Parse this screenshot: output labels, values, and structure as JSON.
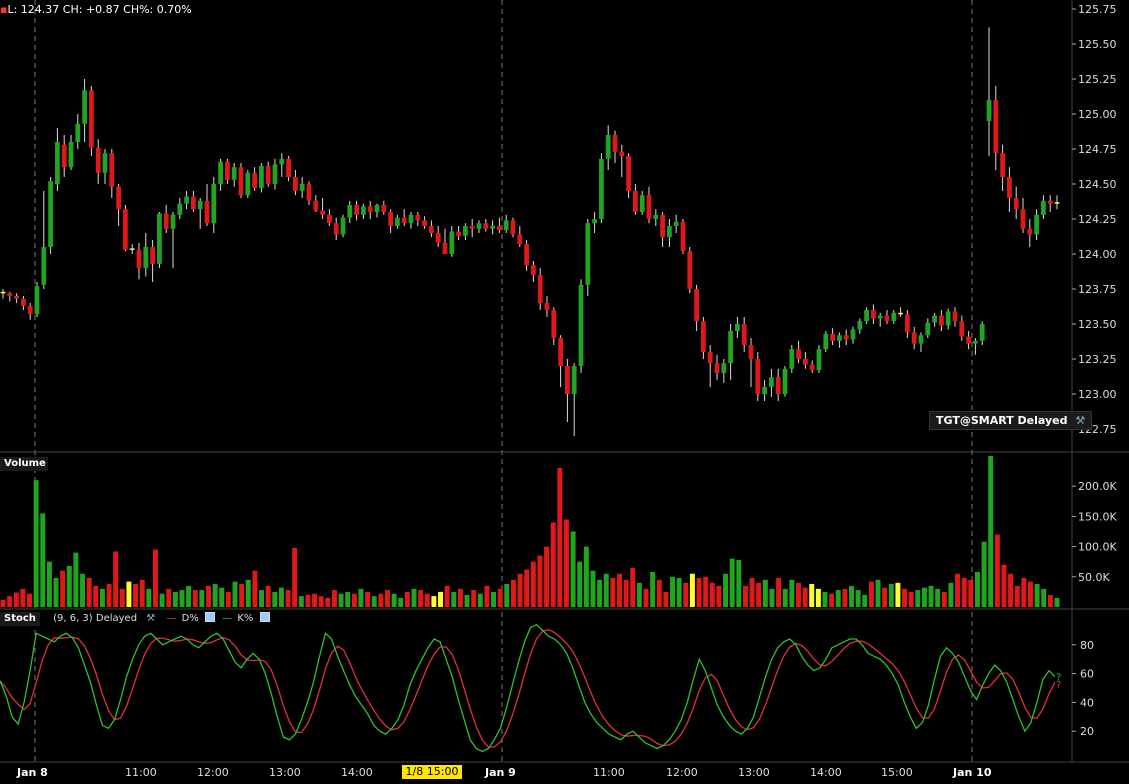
{
  "header": {
    "text": "L: 124.37 CH: +0.87 CH%: 0.70%"
  },
  "symbol_badge": "TGT@SMART Delayed",
  "panels": {
    "volume": "Volume",
    "stoch": "Stoch",
    "stoch_params": "(9, 6, 3) Delayed",
    "d_label": "D%",
    "k_label": "K%"
  },
  "x_axis": {
    "labels": [
      {
        "text": "Jan 8",
        "bold": true
      },
      {
        "text": "11:00"
      },
      {
        "text": "12:00"
      },
      {
        "text": "13:00"
      },
      {
        "text": "14:00"
      },
      {
        "text": "1/8 15:00",
        "highlight": true
      },
      {
        "text": "Jan 9",
        "bold": true
      },
      {
        "text": "11:00"
      },
      {
        "text": "12:00"
      },
      {
        "text": "13:00"
      },
      {
        "text": "14:00"
      },
      {
        "text": "15:00"
      },
      {
        "text": "Jan 10",
        "bold": true
      }
    ]
  },
  "chart_data": {
    "type": "candlestick",
    "price_axis": {
      "ticks": [
        "125.75",
        "125.50",
        "125.25",
        "125.00",
        "124.75",
        "124.50",
        "124.25",
        "124.00",
        "123.75",
        "123.50",
        "123.25",
        "123.00",
        "122.75"
      ],
      "range": [
        122.6,
        125.8
      ]
    },
    "volume_axis": {
      "ticks": [
        "200.0K",
        "150.0K",
        "100.0K",
        "50.0K"
      ],
      "range": [
        0,
        240
      ]
    },
    "stoch_axis": {
      "ticks": [
        "80",
        "60",
        "40",
        "20"
      ],
      "range": [
        0,
        100
      ]
    },
    "day_separators": [
      "Jan 8",
      "Jan 9",
      "Jan 10"
    ],
    "colors": {
      "up": "#1fa51f",
      "down": "#e01818",
      "neutral": "#ffff33",
      "d_line": "#e0303a",
      "k_line": "#30c030"
    },
    "candles": [
      [
        123.73,
        123.75,
        123.68,
        123.72
      ],
      [
        123.72,
        123.73,
        123.66,
        123.7
      ],
      [
        123.7,
        123.72,
        123.65,
        123.68
      ],
      [
        123.68,
        123.7,
        123.6,
        123.63
      ],
      [
        123.63,
        123.65,
        123.53,
        123.57
      ],
      [
        123.57,
        123.8,
        123.55,
        123.77
      ],
      [
        123.78,
        124.45,
        123.75,
        124.05
      ],
      [
        124.05,
        124.55,
        124.0,
        124.52
      ],
      [
        124.5,
        124.9,
        124.45,
        124.8
      ],
      [
        124.78,
        124.85,
        124.55,
        124.62
      ],
      [
        124.62,
        124.85,
        124.6,
        124.8
      ],
      [
        124.8,
        125.0,
        124.75,
        124.93
      ],
      [
        124.93,
        125.25,
        124.8,
        125.17
      ],
      [
        125.17,
        125.2,
        124.7,
        124.76
      ],
      [
        124.76,
        124.82,
        124.5,
        124.58
      ],
      [
        124.58,
        124.75,
        124.5,
        124.72
      ],
      [
        124.72,
        124.75,
        124.4,
        124.48
      ],
      [
        124.48,
        124.5,
        124.2,
        124.32
      ],
      [
        124.32,
        124.35,
        124.02,
        124.03
      ],
      [
        124.04,
        124.07,
        124.0,
        124.03
      ],
      [
        124.03,
        124.08,
        123.82,
        123.9
      ],
      [
        123.9,
        124.15,
        123.84,
        124.05
      ],
      [
        124.05,
        124.1,
        123.8,
        123.93
      ],
      [
        123.93,
        124.3,
        123.9,
        124.29
      ],
      [
        124.29,
        124.35,
        124.15,
        124.18
      ],
      [
        124.18,
        124.3,
        123.9,
        124.28
      ],
      [
        124.28,
        124.4,
        124.25,
        124.36
      ],
      [
        124.36,
        124.45,
        124.32,
        124.41
      ],
      [
        124.41,
        124.45,
        124.3,
        124.32
      ],
      [
        124.32,
        124.4,
        124.18,
        124.38
      ],
      [
        124.38,
        124.5,
        124.2,
        124.22
      ],
      [
        124.22,
        124.55,
        124.15,
        124.5
      ],
      [
        124.5,
        124.68,
        124.45,
        124.66
      ],
      [
        124.66,
        124.68,
        124.5,
        124.53
      ],
      [
        124.53,
        124.65,
        124.48,
        124.62
      ],
      [
        124.62,
        124.65,
        124.4,
        124.42
      ],
      [
        124.42,
        124.6,
        124.4,
        124.58
      ],
      [
        124.58,
        124.62,
        124.45,
        124.47
      ],
      [
        124.47,
        124.65,
        124.44,
        124.63
      ],
      [
        124.63,
        124.66,
        124.48,
        124.5
      ],
      [
        124.5,
        124.68,
        124.46,
        124.64
      ],
      [
        124.64,
        124.72,
        124.55,
        124.68
      ],
      [
        124.68,
        124.7,
        124.52,
        124.55
      ],
      [
        124.55,
        124.6,
        124.42,
        124.45
      ],
      [
        124.45,
        124.55,
        124.4,
        124.5
      ],
      [
        124.5,
        124.52,
        124.35,
        124.38
      ],
      [
        124.38,
        124.42,
        124.3,
        124.31
      ],
      [
        124.31,
        124.4,
        124.25,
        124.28
      ],
      [
        124.28,
        124.32,
        124.2,
        124.22
      ],
      [
        124.22,
        124.26,
        124.1,
        124.14
      ],
      [
        124.14,
        124.28,
        124.12,
        124.26
      ],
      [
        124.26,
        124.38,
        124.22,
        124.35
      ],
      [
        124.35,
        124.38,
        124.24,
        124.28
      ],
      [
        124.28,
        124.36,
        124.25,
        124.34
      ],
      [
        124.34,
        124.38,
        124.25,
        124.3
      ],
      [
        124.3,
        124.36,
        124.26,
        124.35
      ],
      [
        124.35,
        124.38,
        124.28,
        124.3
      ],
      [
        124.3,
        124.32,
        124.15,
        124.2
      ],
      [
        124.2,
        124.28,
        124.18,
        124.26
      ],
      [
        124.26,
        124.32,
        124.2,
        124.22
      ],
      [
        124.22,
        124.3,
        124.18,
        124.28
      ],
      [
        124.28,
        124.3,
        124.2,
        124.24
      ],
      [
        124.24,
        124.27,
        124.18,
        124.2
      ],
      [
        124.2,
        124.24,
        124.12,
        124.15
      ],
      [
        124.15,
        124.2,
        124.05,
        124.08
      ],
      [
        124.08,
        124.18,
        124.0,
        124.0
      ],
      [
        124.0,
        124.2,
        123.98,
        124.16
      ],
      [
        124.16,
        124.2,
        124.1,
        124.13
      ],
      [
        124.13,
        124.22,
        124.1,
        124.2
      ],
      [
        124.2,
        124.25,
        124.12,
        124.18
      ],
      [
        124.18,
        124.24,
        124.15,
        124.22
      ],
      [
        124.22,
        124.25,
        124.16,
        124.18
      ],
      [
        124.18,
        124.24,
        124.14,
        124.2
      ],
      [
        124.2,
        124.26,
        124.15,
        124.17
      ],
      [
        124.17,
        124.28,
        124.15,
        124.24
      ],
      [
        124.24,
        124.26,
        124.12,
        124.14
      ],
      [
        124.14,
        124.2,
        124.05,
        124.07
      ],
      [
        124.07,
        124.1,
        123.88,
        123.92
      ],
      [
        123.92,
        123.95,
        123.8,
        123.85
      ],
      [
        123.85,
        123.9,
        123.6,
        123.65
      ],
      [
        123.65,
        123.7,
        123.55,
        123.6
      ],
      [
        123.6,
        123.62,
        123.35,
        123.4
      ],
      [
        123.4,
        123.42,
        123.05,
        123.2
      ],
      [
        123.2,
        123.25,
        122.8,
        123.0
      ],
      [
        123.0,
        123.22,
        122.7,
        123.2
      ],
      [
        123.2,
        123.82,
        123.15,
        123.78
      ],
      [
        123.78,
        124.25,
        123.7,
        124.22
      ],
      [
        124.22,
        124.3,
        124.15,
        124.25
      ],
      [
        124.25,
        124.72,
        124.22,
        124.68
      ],
      [
        124.68,
        124.92,
        124.6,
        124.85
      ],
      [
        124.85,
        124.88,
        124.65,
        124.73
      ],
      [
        124.73,
        124.78,
        124.55,
        124.7
      ],
      [
        124.7,
        124.72,
        124.4,
        124.45
      ],
      [
        124.45,
        124.5,
        124.28,
        124.3
      ],
      [
        124.3,
        124.45,
        124.28,
        124.42
      ],
      [
        124.42,
        124.48,
        124.22,
        124.25
      ],
      [
        124.25,
        124.32,
        124.2,
        124.28
      ],
      [
        124.28,
        124.3,
        124.05,
        124.12
      ],
      [
        124.12,
        124.25,
        124.05,
        124.2
      ],
      [
        124.2,
        124.28,
        124.15,
        124.23
      ],
      [
        124.23,
        124.25,
        124.0,
        124.02
      ],
      [
        124.02,
        124.05,
        123.72,
        123.75
      ],
      [
        123.75,
        123.78,
        123.45,
        123.52
      ],
      [
        123.52,
        123.55,
        123.25,
        123.3
      ],
      [
        123.3,
        123.35,
        123.05,
        123.22
      ],
      [
        123.22,
        123.28,
        123.1,
        123.15
      ],
      [
        123.15,
        123.25,
        123.08,
        123.22
      ],
      [
        123.22,
        123.5,
        123.1,
        123.45
      ],
      [
        123.45,
        123.55,
        123.4,
        123.5
      ],
      [
        123.5,
        123.55,
        123.3,
        123.35
      ],
      [
        123.35,
        123.4,
        123.05,
        123.25
      ],
      [
        123.25,
        123.3,
        122.95,
        123.0
      ],
      [
        123.0,
        123.1,
        122.95,
        123.05
      ],
      [
        123.05,
        123.18,
        122.98,
        123.12
      ],
      [
        123.12,
        123.18,
        122.95,
        123.0
      ],
      [
        123.0,
        123.2,
        122.98,
        123.18
      ],
      [
        123.18,
        123.35,
        123.15,
        123.32
      ],
      [
        123.32,
        123.38,
        123.22,
        123.25
      ],
      [
        123.25,
        123.3,
        123.18,
        123.21
      ],
      [
        123.21,
        123.24,
        123.15,
        123.17
      ],
      [
        123.17,
        123.35,
        123.15,
        123.32
      ],
      [
        123.32,
        123.45,
        123.3,
        123.43
      ],
      [
        123.43,
        123.47,
        123.35,
        123.38
      ],
      [
        123.38,
        123.44,
        123.33,
        123.42
      ],
      [
        123.42,
        123.46,
        123.35,
        123.39
      ],
      [
        123.39,
        123.48,
        123.36,
        123.46
      ],
      [
        123.46,
        123.54,
        123.43,
        123.52
      ],
      [
        123.52,
        123.62,
        123.5,
        123.6
      ],
      [
        123.6,
        123.64,
        123.5,
        123.54
      ],
      [
        123.54,
        123.58,
        123.48,
        123.56
      ],
      [
        123.56,
        123.6,
        123.5,
        123.52
      ],
      [
        123.52,
        123.6,
        123.5,
        123.58
      ],
      [
        123.58,
        123.62,
        123.55,
        123.57
      ],
      [
        123.57,
        123.6,
        123.4,
        123.44
      ],
      [
        123.44,
        123.48,
        123.32,
        123.36
      ],
      [
        123.36,
        123.44,
        123.3,
        123.42
      ],
      [
        123.42,
        123.54,
        123.4,
        123.51
      ],
      [
        123.51,
        123.58,
        123.48,
        123.56
      ],
      [
        123.56,
        123.6,
        123.45,
        123.49
      ],
      [
        123.49,
        123.61,
        123.46,
        123.59
      ],
      [
        123.59,
        123.62,
        123.48,
        123.52
      ],
      [
        123.52,
        123.56,
        123.38,
        123.41
      ],
      [
        123.41,
        123.45,
        123.32,
        123.36
      ],
      [
        123.36,
        123.4,
        123.28,
        123.38
      ],
      [
        123.38,
        123.52,
        123.35,
        123.5
      ],
      [
        124.95,
        125.62,
        124.7,
        125.1
      ],
      [
        125.1,
        125.2,
        124.6,
        124.72
      ],
      [
        124.72,
        124.78,
        124.45,
        124.55
      ],
      [
        124.55,
        124.62,
        124.3,
        124.4
      ],
      [
        124.4,
        124.48,
        124.25,
        124.32
      ],
      [
        124.32,
        124.4,
        124.15,
        124.18
      ],
      [
        124.18,
        124.25,
        124.05,
        124.14
      ],
      [
        124.14,
        124.32,
        124.1,
        124.28
      ],
      [
        124.28,
        124.42,
        124.25,
        124.38
      ],
      [
        124.38,
        124.42,
        124.3,
        124.36
      ],
      [
        124.36,
        124.42,
        124.32,
        124.37
      ]
    ],
    "volumes": [
      12,
      18,
      24,
      30,
      22,
      210,
      155,
      75,
      48,
      60,
      68,
      90,
      55,
      48,
      35,
      30,
      38,
      92,
      30,
      42,
      38,
      45,
      30,
      95,
      22,
      30,
      25,
      28,
      35,
      28,
      28,
      35,
      38,
      32,
      25,
      42,
      38,
      45,
      60,
      28,
      35,
      25,
      32,
      28,
      98,
      18,
      20,
      22,
      18,
      15,
      28,
      22,
      25,
      22,
      30,
      25,
      18,
      22,
      28,
      22,
      15,
      25,
      30,
      28,
      22,
      18,
      25,
      35,
      25,
      30,
      20,
      28,
      22,
      35,
      25,
      30,
      38,
      45,
      55,
      62,
      75,
      85,
      100,
      140,
      230,
      145,
      125,
      75,
      100,
      60,
      45,
      55,
      48,
      55,
      45,
      65,
      40,
      30,
      58,
      45,
      25,
      50,
      48,
      40,
      55,
      48,
      50,
      40,
      35,
      55,
      80,
      78,
      35,
      48,
      40,
      45,
      30,
      48,
      30,
      45,
      40,
      32,
      38,
      30,
      25,
      22,
      28,
      30,
      35,
      28,
      20,
      42,
      45,
      32,
      38,
      40,
      30,
      25,
      28,
      32,
      35,
      30,
      25,
      40,
      55,
      48,
      45,
      58,
      108,
      250,
      120,
      70,
      55,
      35,
      48,
      42,
      38,
      30,
      20,
      15
    ],
    "neutral_volume_idx": [
      19,
      65,
      66,
      104,
      122,
      123,
      135
    ],
    "stoch_k": [
      55,
      45,
      30,
      25,
      40,
      62,
      88,
      86,
      84,
      82,
      86,
      88,
      85,
      78,
      66,
      54,
      38,
      24,
      22,
      28,
      42,
      58,
      70,
      80,
      86,
      88,
      84,
      80,
      82,
      84,
      86,
      84,
      80,
      78,
      82,
      86,
      88,
      84,
      76,
      68,
      64,
      70,
      74,
      70,
      60,
      46,
      30,
      16,
      14,
      18,
      28,
      40,
      54,
      72,
      88,
      84,
      72,
      62,
      52,
      44,
      38,
      32,
      24,
      20,
      18,
      22,
      28,
      38,
      52,
      62,
      70,
      78,
      84,
      82,
      70,
      58,
      42,
      28,
      14,
      8,
      6,
      8,
      14,
      22,
      36,
      52,
      68,
      82,
      92,
      94,
      90,
      86,
      84,
      80,
      74,
      64,
      52,
      40,
      32,
      26,
      22,
      18,
      16,
      14,
      18,
      20,
      16,
      12,
      10,
      8,
      10,
      14,
      20,
      28,
      40,
      56,
      70,
      62,
      50,
      38,
      30,
      24,
      20,
      18,
      22,
      30,
      44,
      58,
      70,
      78,
      82,
      84,
      80,
      72,
      66,
      62,
      64,
      70,
      78,
      80,
      82,
      84,
      84,
      80,
      74,
      72,
      70,
      66,
      60,
      52,
      40,
      30,
      22,
      26,
      38,
      56,
      72,
      78,
      74,
      68,
      58,
      48,
      42,
      52,
      60,
      66,
      62,
      54,
      42,
      30,
      20,
      26,
      40,
      56,
      62,
      58
    ]
  }
}
